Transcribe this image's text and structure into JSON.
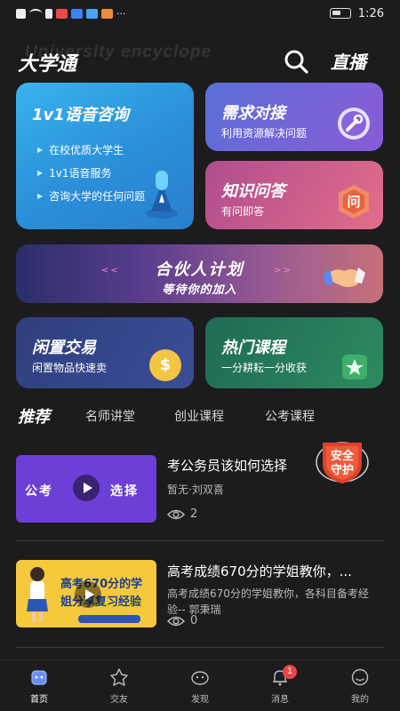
{
  "status_bar": {
    "time": "1:26",
    "more": "···"
  },
  "header": {
    "watermark": "University encyclope",
    "title": "大学通",
    "live_label": "直播"
  },
  "cards": {
    "voice": {
      "title": "1v1语音咨询",
      "items": [
        "在校优质大学生",
        "1v1语音服务",
        "咨询大学的任何问题"
      ]
    },
    "demand": {
      "title": "需求对接",
      "subtitle": "利用资源解决问题"
    },
    "knowledge": {
      "title": "知识问答",
      "subtitle": "有问即答",
      "icon_text": "问"
    },
    "partner": {
      "title": "合伙人计划",
      "subtitle": "等待你的加入"
    },
    "trade": {
      "title": "闲置交易",
      "subtitle": "闲置物品快速卖"
    },
    "course": {
      "title": "热门课程",
      "subtitle": "一分耕耘一分收获"
    }
  },
  "tabs": [
    {
      "label": "推荐",
      "active": true
    },
    {
      "label": "名师讲堂",
      "active": false
    },
    {
      "label": "创业课程",
      "active": false
    },
    {
      "label": "公考课程",
      "active": false
    }
  ],
  "articles": [
    {
      "title": "考公务员该如何选择",
      "meta": "暂无·刘双喜",
      "views": "2",
      "thumb_words": [
        "公考",
        "选择"
      ]
    },
    {
      "title": "高考成绩670分的学姐教你，...",
      "meta_line1": "高考成绩670分的学姐教你，各科目备考经",
      "meta_line2": "验-- 郭秉瑞",
      "views": "0",
      "thumb_lines": [
        "高考670分的学",
        "姐分享复习经验"
      ]
    }
  ],
  "safe_badge": {
    "line1": "安全",
    "line2": "守护"
  },
  "bottom_nav": [
    {
      "label": "首页",
      "icon": "home-icon",
      "active": true
    },
    {
      "label": "交友",
      "icon": "star-face-icon",
      "active": false
    },
    {
      "label": "发现",
      "icon": "discover-icon",
      "active": false
    },
    {
      "label": "消息",
      "icon": "bell-icon",
      "active": false,
      "badge": "1"
    },
    {
      "label": "我的",
      "icon": "profile-icon",
      "active": false
    }
  ],
  "colors": {
    "background": "#1c1c1e",
    "voice_card": "#2a8fd8",
    "demand_card": "#6b64d8",
    "knowledge_card": "#d05e8b",
    "trade_card": "#34448a",
    "course_card": "#267a5a",
    "badge_red": "#f04343"
  }
}
